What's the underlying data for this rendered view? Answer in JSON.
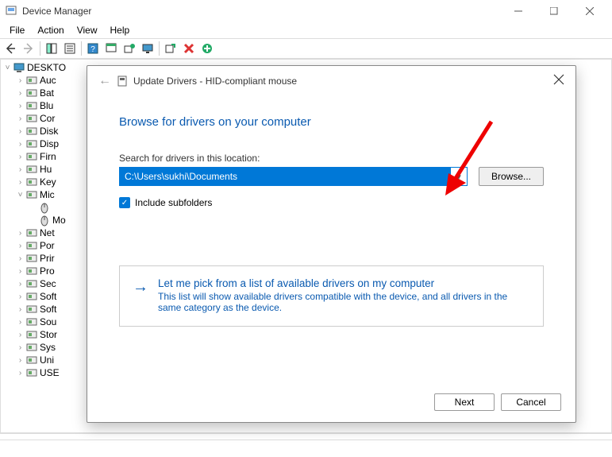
{
  "window": {
    "title": "Device Manager"
  },
  "menu": {
    "file": "File",
    "action": "Action",
    "view": "View",
    "help": "Help"
  },
  "tree": {
    "root": "DESKTO",
    "items": [
      {
        "label": "Auc"
      },
      {
        "label": "Bat"
      },
      {
        "label": "Blu"
      },
      {
        "label": "Cor"
      },
      {
        "label": "Disk"
      },
      {
        "label": "Disp"
      },
      {
        "label": "Firn"
      },
      {
        "label": "Hu"
      },
      {
        "label": "Key"
      },
      {
        "label": "Mic",
        "expanded": true,
        "children": [
          {
            "label": ""
          },
          {
            "label": "Mo"
          }
        ]
      },
      {
        "label": "Net"
      },
      {
        "label": "Por"
      },
      {
        "label": "Prir"
      },
      {
        "label": "Pro"
      },
      {
        "label": "Sec"
      },
      {
        "label": "Soft"
      },
      {
        "label": "Soft"
      },
      {
        "label": "Sou"
      },
      {
        "label": "Stor"
      },
      {
        "label": "Sys"
      },
      {
        "label": "Uni"
      },
      {
        "label": "USE"
      }
    ]
  },
  "dialog": {
    "title": "Update Drivers - HID-compliant mouse",
    "heading": "Browse for drivers on your computer",
    "search_label": "Search for drivers in this location:",
    "path_value": "C:\\Users\\sukhi\\Documents",
    "browse_btn": "Browse...",
    "include_subfolders": "Include subfolders",
    "pick_title": "Let me pick from a list of available drivers on my computer",
    "pick_desc": "This list will show available drivers compatible with the device, and all drivers in the same category as the device.",
    "next_btn": "Next",
    "cancel_btn": "Cancel"
  }
}
